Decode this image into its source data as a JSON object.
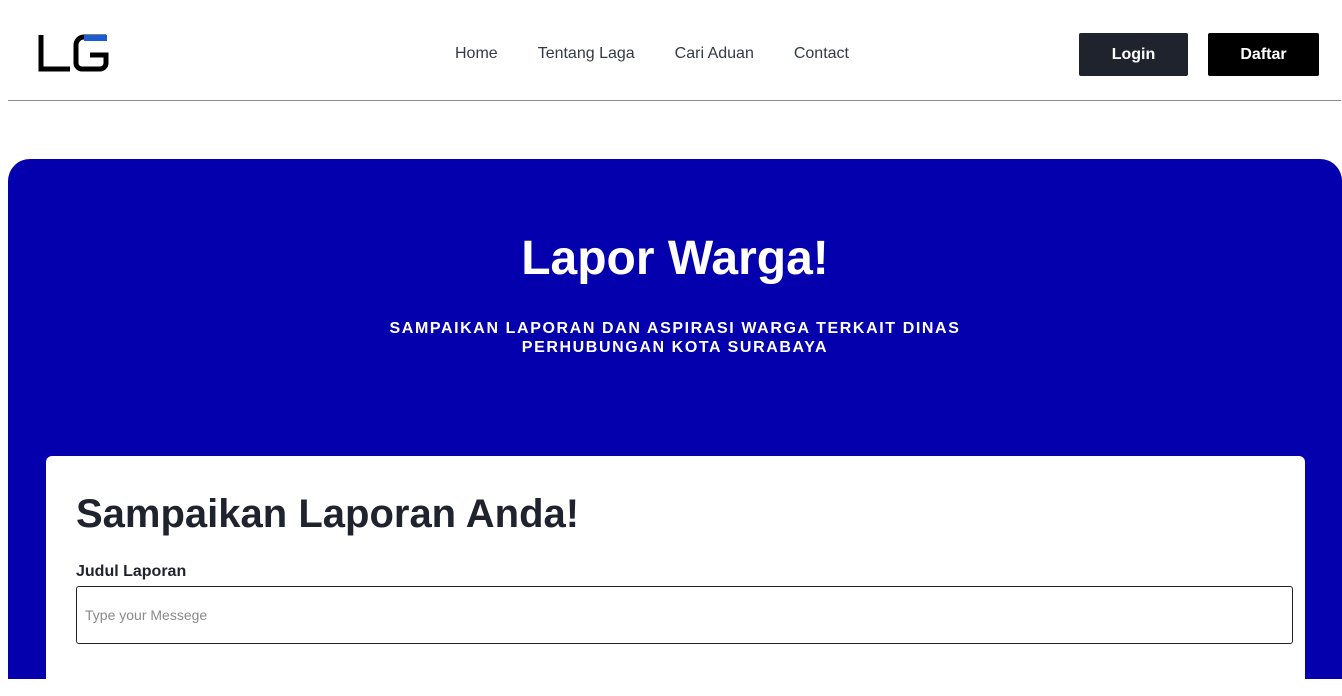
{
  "brand": {
    "logo_icon": "lg-logo-icon",
    "colors": {
      "logo_black": "#000000",
      "logo_blue": "#1a5bd6"
    }
  },
  "nav": {
    "items": [
      {
        "label": "Home"
      },
      {
        "label": "Tentang Laga"
      },
      {
        "label": "Cari Aduan"
      },
      {
        "label": "Contact"
      }
    ]
  },
  "auth": {
    "login_label": "Login",
    "register_label": "Daftar"
  },
  "hero": {
    "title": "Lapor Warga!",
    "subtitle": "SAMPAIKAN LAPORAN DAN ASPIRASI WARGA TERKAIT DINAS PERHUBUNGAN KOTA SURABAYA",
    "background_color": "#0500ad"
  },
  "form": {
    "title": "Sampaikan Laporan Anda!",
    "judul": {
      "label": "Judul Laporan",
      "placeholder": "Type your Messege",
      "value": ""
    }
  }
}
